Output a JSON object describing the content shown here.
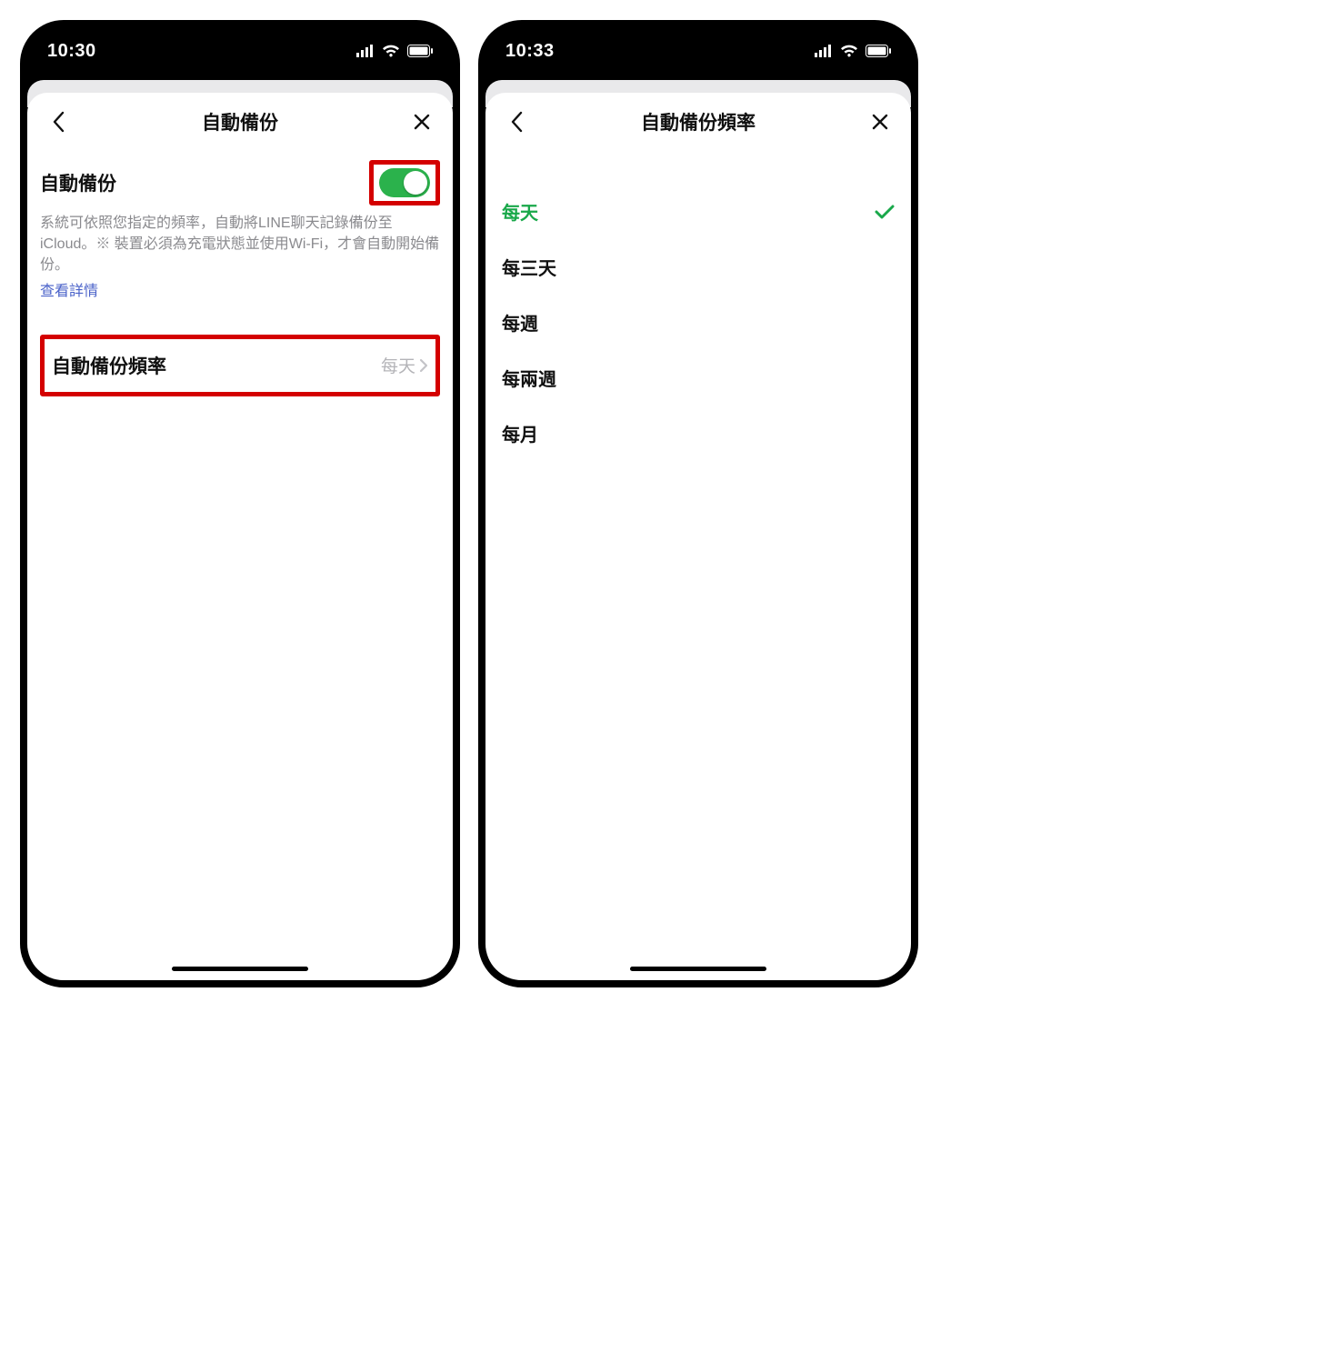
{
  "colors": {
    "accent_green": "#2bb24c",
    "text_muted": "#8a8a8e",
    "link": "#4a62c9",
    "highlight": "#d40000"
  },
  "left": {
    "status_time": "10:30",
    "nav_title": "自動備份",
    "section_title": "自動備份",
    "toggle_on": true,
    "description": "系統可依照您指定的頻率，自動將LINE聊天記錄備份至iCloud。※ 裝置必須為充電狀態並使用Wi-Fi，才會自動開始備份。",
    "details_link": "查看詳情",
    "freq_label": "自動備份頻率",
    "freq_value": "每天"
  },
  "right": {
    "status_time": "10:33",
    "nav_title": "自動備份頻率",
    "options": [
      {
        "label": "每天",
        "selected": true
      },
      {
        "label": "每三天",
        "selected": false
      },
      {
        "label": "每週",
        "selected": false
      },
      {
        "label": "每兩週",
        "selected": false
      },
      {
        "label": "每月",
        "selected": false
      }
    ]
  }
}
